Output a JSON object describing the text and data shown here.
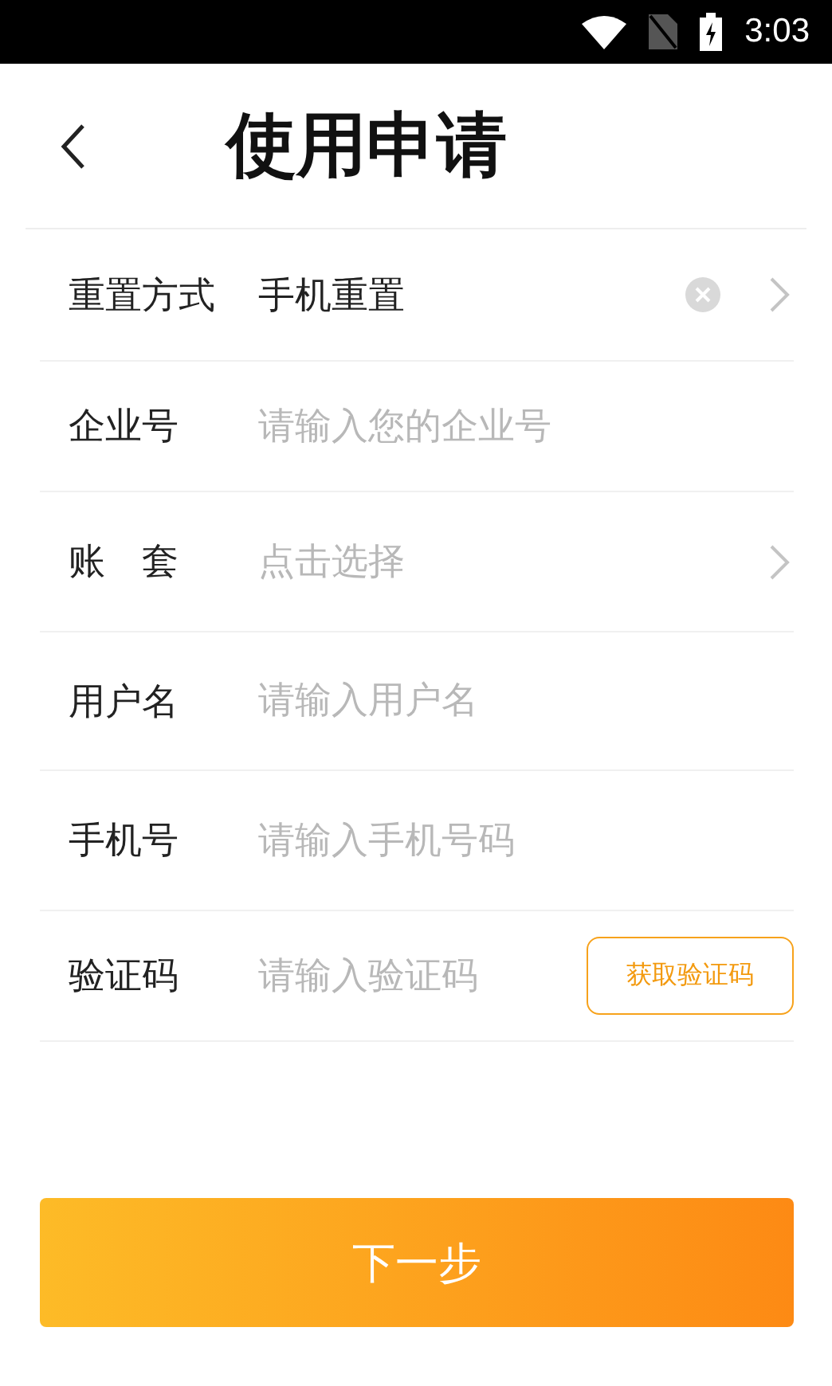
{
  "status_bar": {
    "time": "3:03"
  },
  "header": {
    "title": "使用申请"
  },
  "rows": [
    {
      "kind": "value",
      "label": "重置方式",
      "value": "手机重置",
      "clearable": true,
      "chevron": true
    },
    {
      "kind": "input",
      "label": "企业号",
      "placeholder": "请输入您的企业号",
      "chevron": false
    },
    {
      "kind": "input",
      "label": "账　套",
      "placeholder": "点击选择",
      "chevron": true
    },
    {
      "kind": "input",
      "label": "用户名",
      "placeholder": "请输入用户名",
      "chevron": false
    },
    {
      "kind": "input",
      "label": "手机号",
      "placeholder": "请输入手机号码",
      "chevron": false
    },
    {
      "kind": "code",
      "label": "验证码",
      "placeholder": "请输入验证码",
      "button": "获取验证码",
      "chevron": false
    }
  ],
  "next_button": {
    "label": "下一步"
  }
}
